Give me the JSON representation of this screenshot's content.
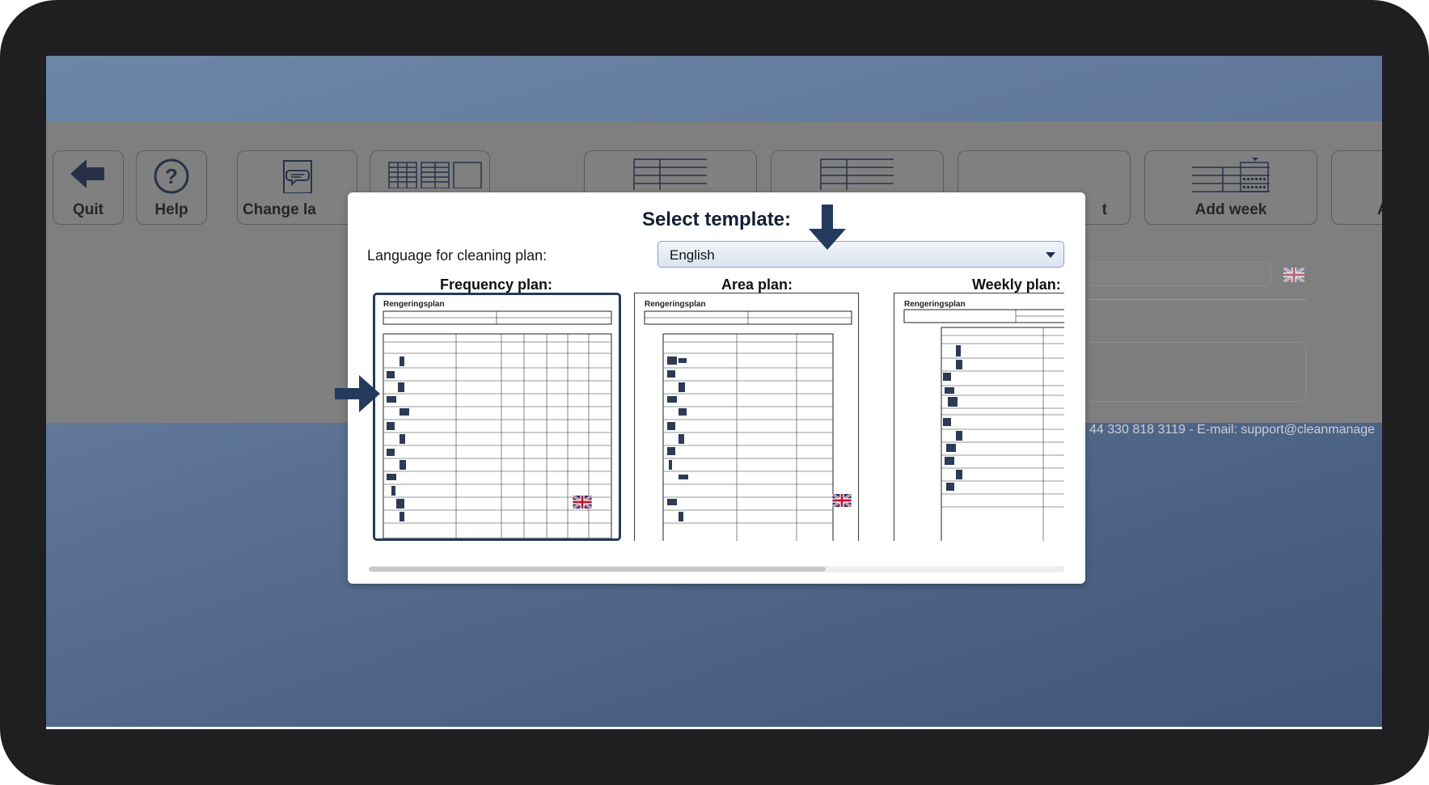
{
  "toolbar": {
    "quit_label": "Quit",
    "help_label": "Help",
    "change_language_label": "Change la",
    "print_label": "t",
    "add_week_label": "Add week",
    "next_label": "A"
  },
  "background": {
    "footer_text": "44 330 818 3119 - E-mail: support@cleanmanage"
  },
  "dialog": {
    "title": "Select template:",
    "language_label": "Language for cleaning plan:",
    "language_selected": "English",
    "templates": [
      {
        "heading": "Frequency plan:",
        "doc_title": "Rengeringsplan"
      },
      {
        "heading": "Area plan:",
        "doc_title": "Rengeringsplan"
      },
      {
        "heading": "Weekly plan:",
        "doc_title": "Rengeringsplan"
      }
    ]
  },
  "colors": {
    "accent": "#243a5c",
    "screen_bg": "#61789a",
    "overlay": "#7f7f7f",
    "frame": "#1f1e20"
  },
  "icons": [
    "arrow-left-icon",
    "help-question-icon",
    "speech-bubble-icon",
    "table-grid-icon",
    "uk-flag-icon",
    "arrow-down-icon",
    "arrow-right-icon",
    "dropdown-caret-icon"
  ]
}
